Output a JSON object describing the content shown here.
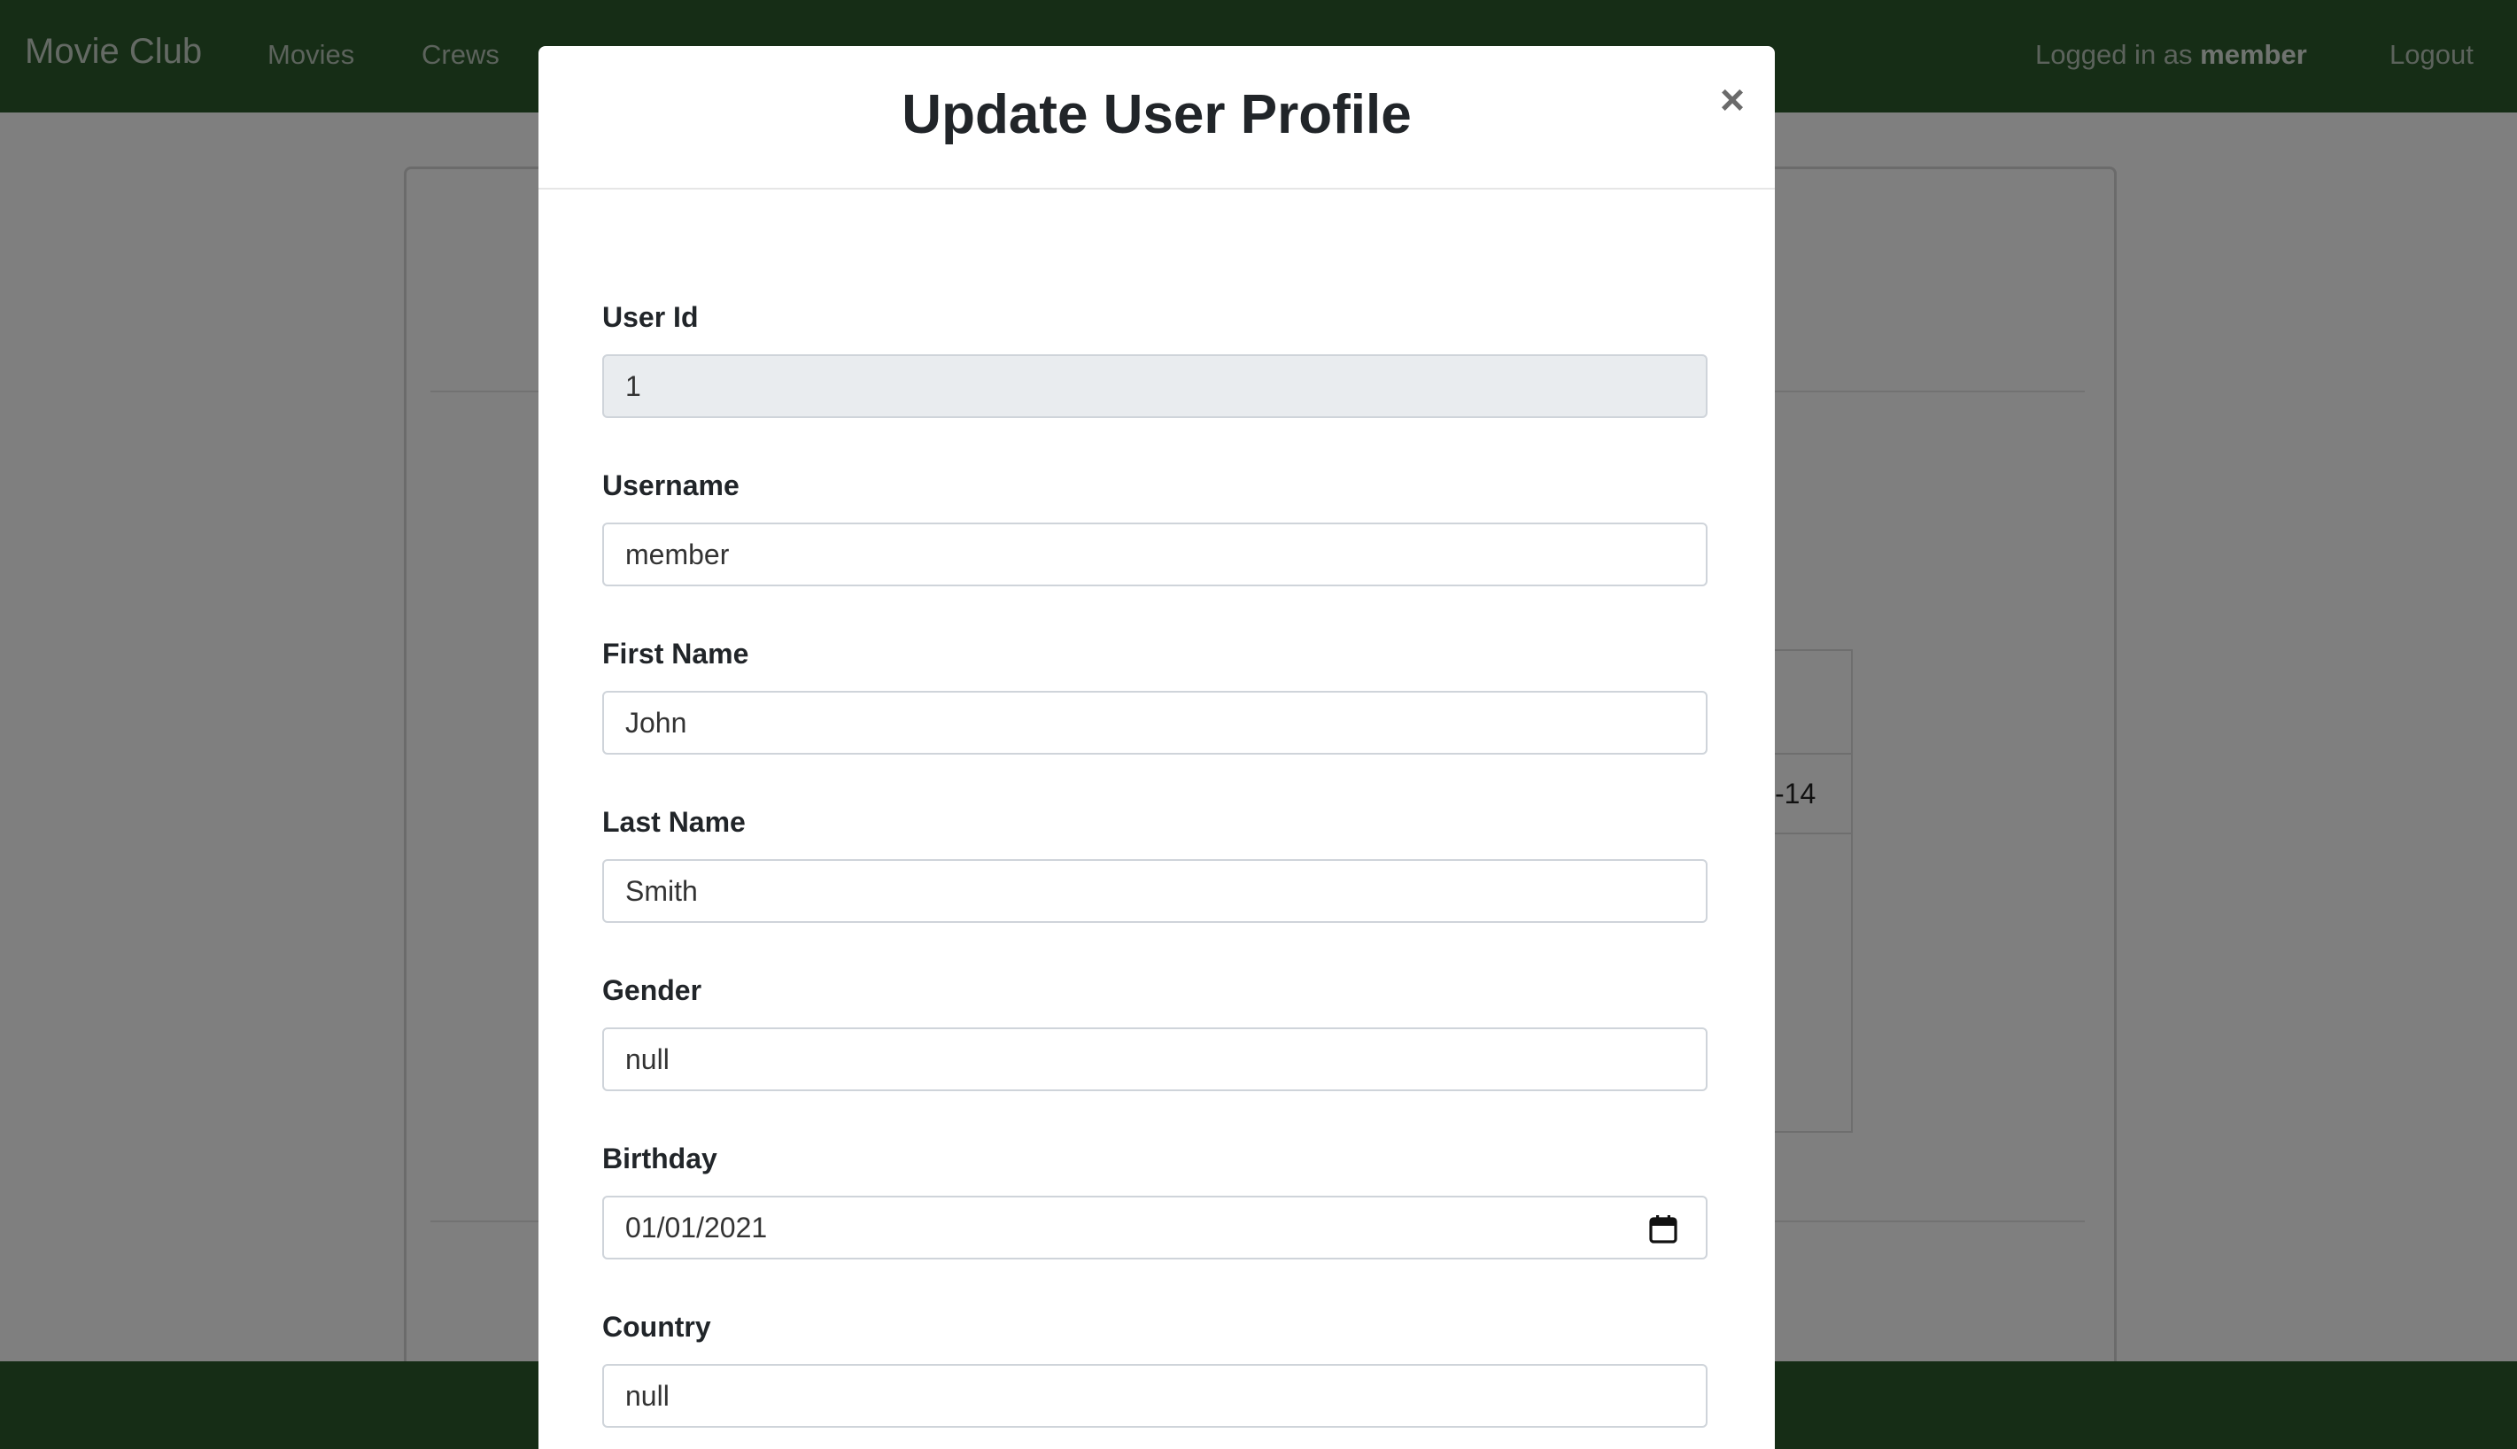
{
  "navbar": {
    "brand": "Movie Club",
    "links": [
      "Movies",
      "Crews"
    ],
    "logged_in_prefix": "Logged in as",
    "logged_in_user": "member",
    "logout": "Logout"
  },
  "background": {
    "table_cell": "-14"
  },
  "modal": {
    "title": "Update User Profile",
    "close": "×",
    "fields": {
      "user_id": {
        "label": "User Id",
        "value": "1"
      },
      "username": {
        "label": "Username",
        "value": "member"
      },
      "first_name": {
        "label": "First Name",
        "value": "John"
      },
      "last_name": {
        "label": "Last Name",
        "value": "Smith"
      },
      "gender": {
        "label": "Gender",
        "value": "null"
      },
      "birthday": {
        "label": "Birthday",
        "value": "01/01/2021"
      },
      "country": {
        "label": "Country",
        "value": "null"
      }
    }
  },
  "colors": {
    "navbar": "#2d5a2d",
    "footer": "#2d5a2d"
  }
}
